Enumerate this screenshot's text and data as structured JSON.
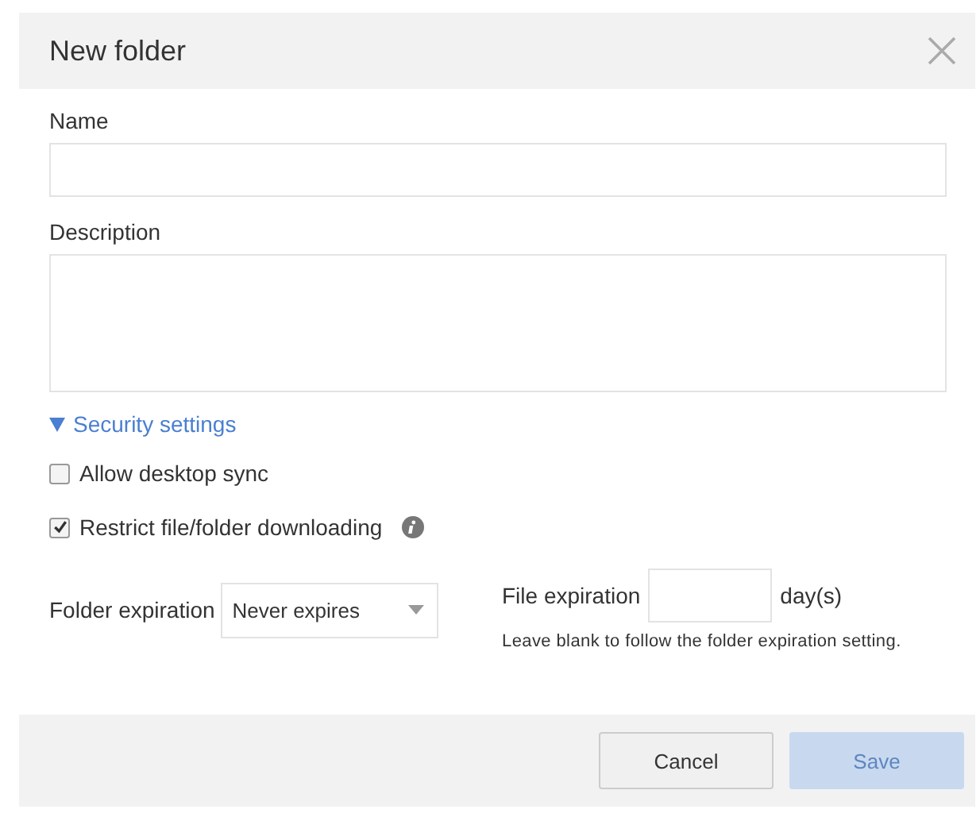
{
  "dialog": {
    "title": "New folder"
  },
  "fields": [
    {
      "label": "Name",
      "kind": "input"
    },
    {
      "label": "Description",
      "kind": "textarea"
    }
  ],
  "security": {
    "label": "Security settings",
    "expanded": true
  },
  "options": [
    {
      "label": "Allow desktop sync",
      "checked": false,
      "info": false
    },
    {
      "label": "Restrict file/folder downloading",
      "checked": true,
      "info": true
    }
  ],
  "folder_expiration": {
    "label": "Folder expiration",
    "value": "Never expires"
  },
  "file_expiration": {
    "label": "File expiration",
    "unit": "day(s)",
    "hint": "Leave blank to follow the folder expiration setting."
  },
  "buttons": [
    {
      "label": "Cancel",
      "kind": "secondary",
      "disabled": false
    },
    {
      "label": "Save",
      "kind": "primary",
      "disabled": true
    }
  ]
}
